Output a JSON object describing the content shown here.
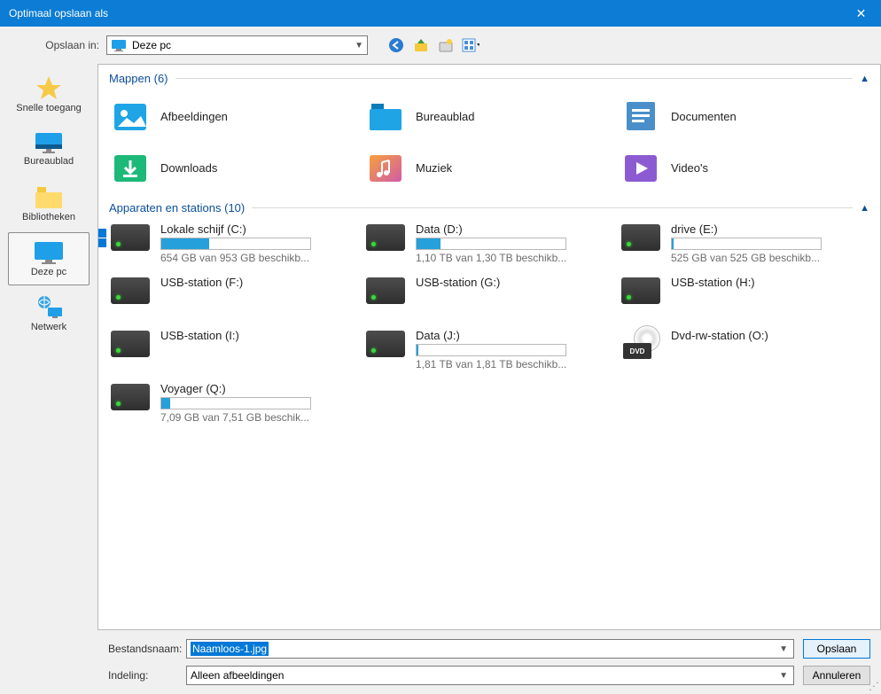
{
  "titlebar": {
    "title": "Optimaal opslaan als"
  },
  "toolbar": {
    "label": "Opslaan in:",
    "current": "Deze pc"
  },
  "sidebar": {
    "items": [
      {
        "label": "Snelle toegang"
      },
      {
        "label": "Bureaublad"
      },
      {
        "label": "Bibliotheken"
      },
      {
        "label": "Deze pc"
      },
      {
        "label": "Netwerk"
      }
    ]
  },
  "sections": {
    "folders": {
      "title": "Mappen",
      "count": "(6)"
    },
    "drives": {
      "title": "Apparaten en stations",
      "count": "(10)"
    }
  },
  "folders": [
    {
      "label": "Afbeeldingen"
    },
    {
      "label": "Bureaublad"
    },
    {
      "label": "Documenten"
    },
    {
      "label": "Downloads"
    },
    {
      "label": "Muziek"
    },
    {
      "label": "Video's"
    }
  ],
  "drives": [
    {
      "name": "Lokale schijf (C:)",
      "sub": "654 GB van 953 GB beschikb...",
      "fill": 32,
      "hasBar": true,
      "winLogo": true
    },
    {
      "name": "Data (D:)",
      "sub": "1,10 TB van 1,30 TB beschikb...",
      "fill": 16,
      "hasBar": true
    },
    {
      "name": "drive (E:)",
      "sub": "525 GB van 525 GB beschikb...",
      "fill": 1,
      "hasBar": true
    },
    {
      "name": "USB-station (F:)",
      "hasBar": false
    },
    {
      "name": "USB-station (G:)",
      "hasBar": false
    },
    {
      "name": "USB-station (H:)",
      "hasBar": false
    },
    {
      "name": "USB-station (I:)",
      "hasBar": false
    },
    {
      "name": "Data (J:)",
      "sub": "1,81 TB van 1,81 TB beschikb...",
      "fill": 1,
      "hasBar": true
    },
    {
      "name": "Dvd-rw-station (O:)",
      "hasBar": false,
      "dvd": true
    },
    {
      "name": "Voyager (Q:)",
      "sub": "7,09 GB van 7,51 GB beschik...",
      "fill": 6,
      "hasBar": true
    }
  ],
  "bottom": {
    "filenameLabel": "Bestandsnaam:",
    "filenameValue": "Naamloos-1.jpg",
    "formatLabel": "Indeling:",
    "formatValue": "Alleen afbeeldingen",
    "save": "Opslaan",
    "cancel": "Annuleren"
  }
}
